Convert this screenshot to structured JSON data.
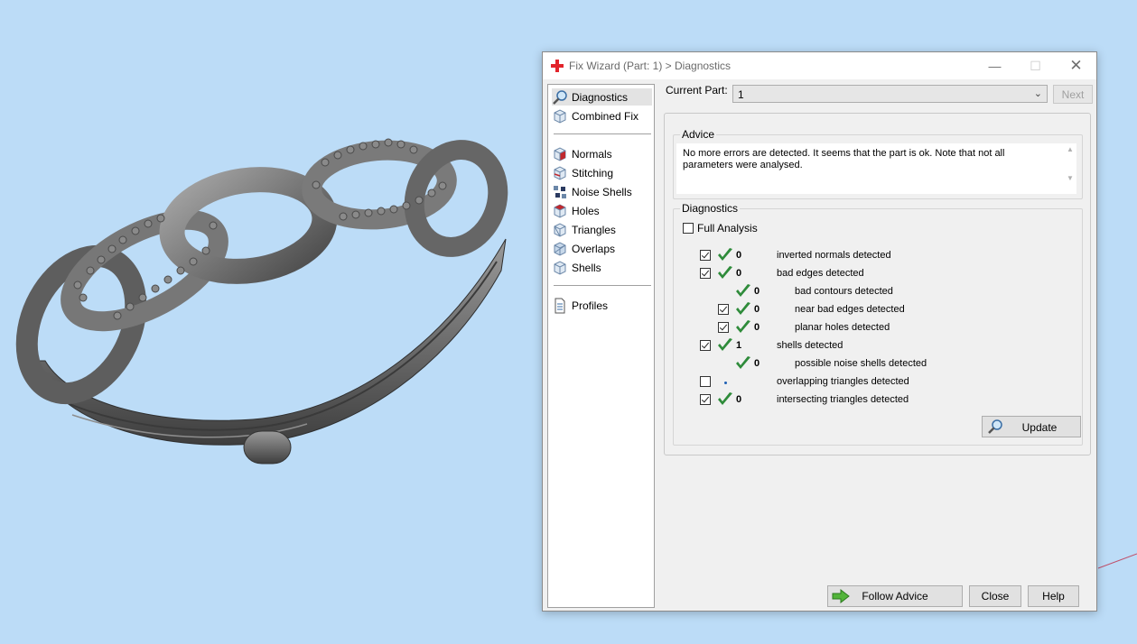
{
  "dialog": {
    "title": "Fix Wizard (Part: 1) > Diagnostics",
    "window_controls": {
      "minimize": "—",
      "maximize": "☐",
      "close": "✕"
    }
  },
  "nav": {
    "items": [
      {
        "label": "Diagnostics",
        "icon": "magnifier-icon",
        "selected": true
      },
      {
        "label": "Combined Fix",
        "icon": "cube-icon"
      },
      {
        "label": "Normals",
        "icon": "normals-cube-icon"
      },
      {
        "label": "Stitching",
        "icon": "stitching-cube-icon"
      },
      {
        "label": "Noise Shells",
        "icon": "noise-shells-icon"
      },
      {
        "label": "Holes",
        "icon": "holes-cube-icon"
      },
      {
        "label": "Triangles",
        "icon": "triangles-cube-icon"
      },
      {
        "label": "Overlaps",
        "icon": "overlaps-cube-icon"
      },
      {
        "label": "Shells",
        "icon": "shells-cube-icon"
      },
      {
        "label": "Profiles",
        "icon": "document-icon"
      }
    ]
  },
  "current_part": {
    "label": "Current Part:",
    "value": "1",
    "next_label": "Next"
  },
  "advice": {
    "title": "Advice",
    "text": "No more errors are detected. It seems that the part is ok. Note that not all parameters were analysed."
  },
  "diagnostics": {
    "title": "Diagnostics",
    "full_analysis_label": "Full Analysis",
    "full_analysis_checked": false,
    "rows": [
      {
        "checkbox": true,
        "checked": true,
        "status": "ok",
        "count": "0",
        "label": "inverted normals detected",
        "indent": 0
      },
      {
        "checkbox": true,
        "checked": true,
        "status": "ok",
        "count": "0",
        "label": "bad edges detected",
        "indent": 0
      },
      {
        "checkbox": false,
        "checked": false,
        "status": "ok",
        "count": "0",
        "label": "bad contours detected",
        "indent": 1
      },
      {
        "checkbox": true,
        "checked": true,
        "status": "ok",
        "count": "0",
        "label": "near bad edges detected",
        "indent": 1
      },
      {
        "checkbox": true,
        "checked": true,
        "status": "ok",
        "count": "0",
        "label": "planar holes detected",
        "indent": 1
      },
      {
        "checkbox": true,
        "checked": true,
        "status": "ok",
        "count": "1",
        "label": "shells detected",
        "indent": 0
      },
      {
        "checkbox": false,
        "checked": false,
        "status": "ok",
        "count": "0",
        "label": "possible noise shells detected",
        "indent": 1
      },
      {
        "checkbox": true,
        "checked": false,
        "status": "pending",
        "count": "",
        "label": "overlapping triangles detected",
        "indent": 0
      },
      {
        "checkbox": true,
        "checked": true,
        "status": "ok",
        "count": "0",
        "label": "intersecting triangles detected",
        "indent": 0
      }
    ],
    "update_label": "Update"
  },
  "footer": {
    "follow_label": "Follow Advice",
    "close_label": "Close",
    "help_label": "Help"
  },
  "colors": {
    "viewport_bg": "#bcdcf7",
    "ok_tick": "#2e8b3a",
    "title_icon": "#e2242b",
    "model_grey": "#6b6b6b"
  }
}
